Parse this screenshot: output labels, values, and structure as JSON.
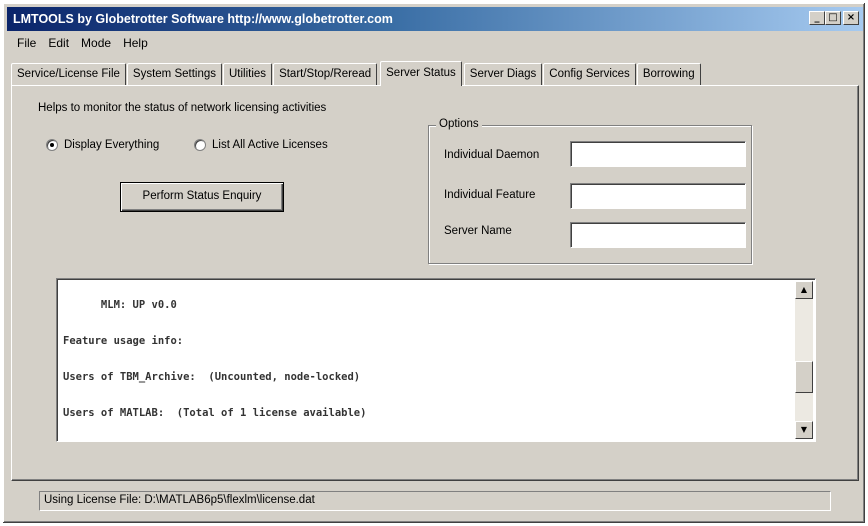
{
  "window": {
    "title": "LMTOOLS by Globetrotter Software http://www.globetrotter.com"
  },
  "title_buttons": {
    "minimize": "_",
    "maximize": "□",
    "close": "×"
  },
  "menu": [
    "File",
    "Edit",
    "Mode",
    "Help"
  ],
  "tabs": [
    "Service/License File",
    "System Settings",
    "Utilities",
    "Start/Stop/Reread",
    "Server Status",
    "Server Diags",
    "Config Services",
    "Borrowing"
  ],
  "active_tab": "Server Status",
  "panel": {
    "help_text": "Helps to monitor the status of network licensing activities",
    "radio_display_everything": "Display Everything",
    "radio_list_active": "List All Active Licenses",
    "selected_radio": "Display Everything",
    "perform_button": "Perform Status Enquiry",
    "options": {
      "legend": "Options",
      "individual_daemon_label": "Individual Daemon",
      "individual_daemon_value": "",
      "individual_feature_label": "Individual Feature",
      "individual_feature_value": "",
      "server_name_label": "Server Name",
      "server_name_value": ""
    },
    "output_lines": [
      "      MLM: UP v0.0",
      "Feature usage info:",
      "Users of TBM_Archive:  (Uncounted, node-locked)",
      "Users of MATLAB:  (Total of 1 license available)"
    ]
  },
  "scrollbar": {
    "up_arrow": "▲",
    "down_arrow": "▼"
  },
  "status": {
    "text": "Using License File:  D:\\MATLAB6p5\\flexlm\\license.dat"
  }
}
